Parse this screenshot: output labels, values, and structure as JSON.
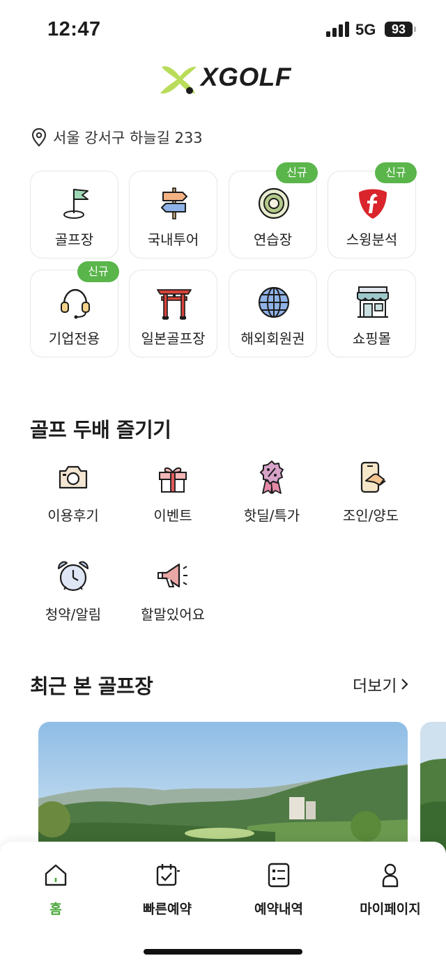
{
  "status_bar": {
    "time": "12:47",
    "network": "5G",
    "battery": "93"
  },
  "app": {
    "logo_text": "XGOLF",
    "brand_color": "#a8d84e",
    "accent_color": "#5ab54b"
  },
  "location": {
    "icon": "map-pin-icon",
    "address": "서울 강서구 하늘길 233"
  },
  "categories": [
    {
      "label": "골프장",
      "icon": "golf-flag-icon",
      "badge": ""
    },
    {
      "label": "국내투어",
      "icon": "signpost-icon",
      "badge": ""
    },
    {
      "label": "연습장",
      "icon": "target-icon",
      "badge": "신규"
    },
    {
      "label": "스윙분석",
      "icon": "swing-analysis-icon",
      "badge": "신규"
    },
    {
      "label": "기업전용",
      "icon": "headset-icon",
      "badge": "신규"
    },
    {
      "label": "일본골프장",
      "icon": "torii-gate-icon",
      "badge": ""
    },
    {
      "label": "해외회원권",
      "icon": "globe-icon",
      "badge": ""
    },
    {
      "label": "쇼핑몰",
      "icon": "storefront-icon",
      "badge": ""
    }
  ],
  "enjoy_section": {
    "title": "골프 두배 즐기기",
    "items": [
      {
        "label": "이용후기",
        "icon": "camera-icon"
      },
      {
        "label": "이벤트",
        "icon": "gift-icon"
      },
      {
        "label": "핫딜/특가",
        "icon": "discount-badge-icon"
      },
      {
        "label": "조인/양도",
        "icon": "phone-handshake-icon"
      },
      {
        "label": "청약/알림",
        "icon": "alarm-clock-icon"
      },
      {
        "label": "할말있어요",
        "icon": "megaphone-icon"
      }
    ]
  },
  "recent_section": {
    "title": "최근 본 골프장",
    "more_label": "더보기"
  },
  "bottom_nav": {
    "items": [
      {
        "label": "홈",
        "icon": "home-icon",
        "active": true
      },
      {
        "label": "빠른예약",
        "icon": "calendar-check-icon",
        "active": false
      },
      {
        "label": "예약내역",
        "icon": "list-doc-icon",
        "active": false
      },
      {
        "label": "마이페이지",
        "icon": "person-icon",
        "active": false
      }
    ]
  }
}
